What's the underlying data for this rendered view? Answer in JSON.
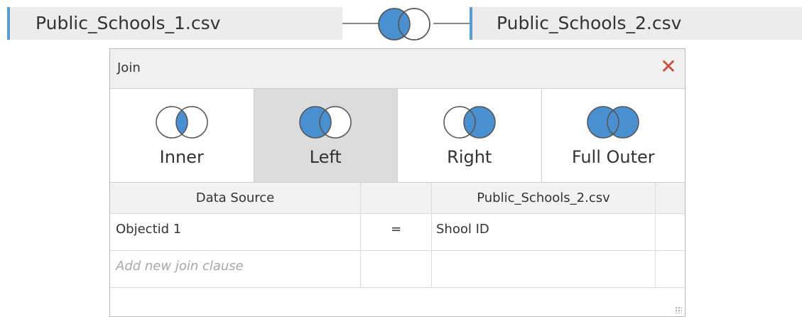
{
  "top_bar": {
    "left_source": "Public_Schools_1.csv",
    "right_source": "Public_Schools_2.csv",
    "join_icon": "left-join-venn-icon"
  },
  "dialog": {
    "title": "Join",
    "close_icon": "close-icon",
    "join_types": [
      {
        "label": "Inner",
        "icon": "inner-join-icon",
        "selected": false
      },
      {
        "label": "Left",
        "icon": "left-join-icon",
        "selected": true
      },
      {
        "label": "Right",
        "icon": "right-join-icon",
        "selected": false
      },
      {
        "label": "Full Outer",
        "icon": "full-outer-join-icon",
        "selected": false
      }
    ],
    "clause_table": {
      "headers": [
        "Data Source",
        "",
        "Public_Schools_2.csv"
      ],
      "rows": [
        {
          "left": "Objectid 1",
          "operator": "=",
          "right": "Shool ID"
        }
      ],
      "add_placeholder": "Add new join clause"
    }
  },
  "colors": {
    "accent_blue": "#4a90d0",
    "source_bar_accent": "#5b9bd5",
    "close_red": "#cc4a3a",
    "selected_bg": "#dcdcdc"
  }
}
